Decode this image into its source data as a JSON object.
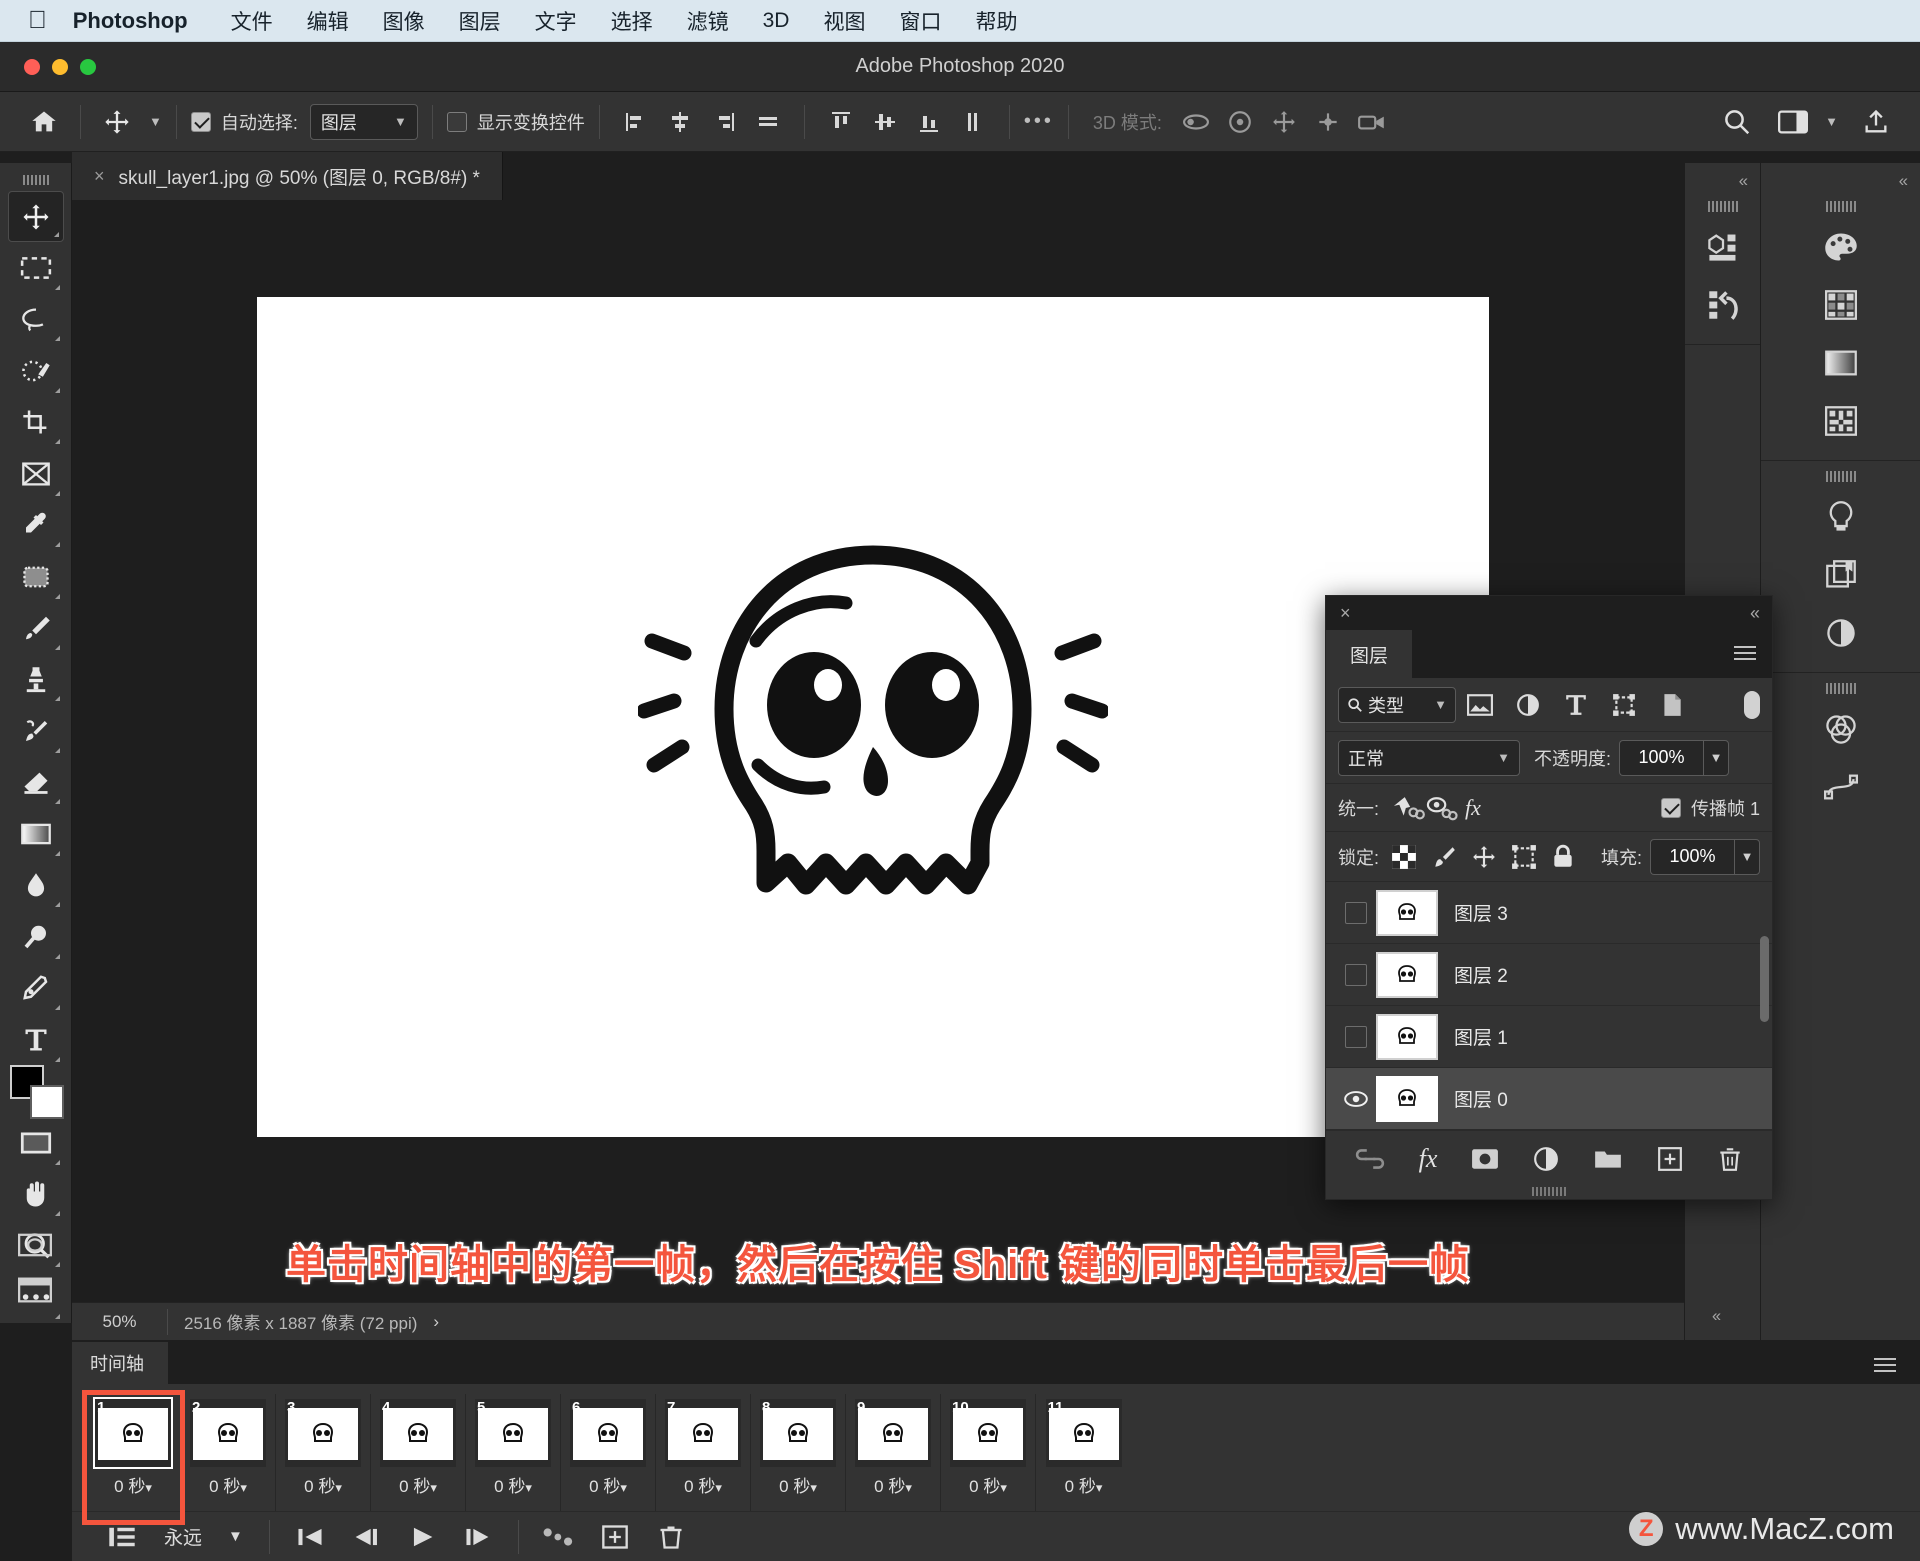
{
  "mac_menu": {
    "apple": "apple-logo",
    "app_name": "Photoshop",
    "items": [
      "文件",
      "编辑",
      "图像",
      "图层",
      "文字",
      "选择",
      "滤镜",
      "3D",
      "视图",
      "窗口",
      "帮助"
    ]
  },
  "window": {
    "title": "Adobe Photoshop 2020"
  },
  "options_bar": {
    "auto_select_label": "自动选择:",
    "auto_select_value": "图层",
    "show_transform_label": "显示变换控件",
    "mode3d_label": "3D 模式:",
    "more_label": "•••"
  },
  "document_tab": {
    "close": "×",
    "title": "skull_layer1.jpg @ 50% (图层 0, RGB/8#) *"
  },
  "status_bar": {
    "zoom": "50%",
    "dimensions": "2516 像素 x 1887 像素 (72 ppi)",
    "arrow": "›"
  },
  "annotation": {
    "text": "单击时间轴中的第一帧，然后在按住 Shift 键的同时单击最后一帧",
    "color": "#f4553d"
  },
  "tools": [
    {
      "name": "move-tool",
      "active": true
    },
    {
      "name": "marquee-tool",
      "active": false
    },
    {
      "name": "lasso-tool",
      "active": false
    },
    {
      "name": "quick-selection-tool",
      "active": false
    },
    {
      "name": "crop-tool",
      "active": false
    },
    {
      "name": "frame-tool",
      "active": false
    },
    {
      "name": "eyedropper-tool",
      "active": false
    },
    {
      "name": "spot-healing-tool",
      "active": false
    },
    {
      "name": "brush-tool",
      "active": false
    },
    {
      "name": "clone-stamp-tool",
      "active": false
    },
    {
      "name": "history-brush-tool",
      "active": false
    },
    {
      "name": "eraser-tool",
      "active": false
    },
    {
      "name": "gradient-tool",
      "active": false
    },
    {
      "name": "blur-tool",
      "active": false
    },
    {
      "name": "dodge-tool",
      "active": false
    },
    {
      "name": "pen-tool",
      "active": false
    },
    {
      "name": "type-tool",
      "active": false
    },
    {
      "name": "path-selection-tool",
      "active": false
    },
    {
      "name": "rectangle-tool",
      "active": false
    },
    {
      "name": "hand-tool",
      "active": false
    },
    {
      "name": "zoom-tool",
      "active": false
    },
    {
      "name": "more-tools",
      "active": false
    }
  ],
  "layers_panel": {
    "close": "×",
    "collapse": "‹‹",
    "tab_label": "图层",
    "filter_placeholder": "类型",
    "filter_icons": [
      "image-filter-icon",
      "adjustment-filter-icon",
      "type-filter-icon",
      "shape-filter-icon",
      "smart-object-filter-icon"
    ],
    "blend_mode": "正常",
    "opacity_label": "不透明度:",
    "opacity_value": "100%",
    "unify_label": "统一:",
    "propagate_label": "传播帧 1",
    "propagate_checked": true,
    "lock_label": "锁定:",
    "fill_label": "填充:",
    "fill_value": "100%",
    "rows": [
      {
        "name": "图层 3",
        "visible": false,
        "selected": false
      },
      {
        "name": "图层 2",
        "visible": false,
        "selected": false
      },
      {
        "name": "图层 1",
        "visible": false,
        "selected": false
      },
      {
        "name": "图层 0",
        "visible": true,
        "selected": true
      }
    ],
    "footer_icons": [
      "link-layers-icon",
      "fx-icon",
      "layer-mask-icon",
      "adjustment-layer-icon",
      "new-group-icon",
      "new-layer-icon",
      "delete-layer-icon"
    ]
  },
  "right_dock": {
    "collapse": "‹‹",
    "group_a": [
      "3d-panel-icon",
      "history-panel-icon"
    ],
    "group_b1": [
      "color-palette-icon",
      "swatches-icon",
      "gradients-icon",
      "patterns-icon"
    ],
    "group_b2": [
      "adjustments-icon",
      "libraries-icon",
      "properties-icon"
    ],
    "group_b3": [
      "channels-icon",
      "paths-icon"
    ]
  },
  "timeline": {
    "tab_label": "时间轴",
    "loop_value": "永远",
    "frames": [
      {
        "num": "1",
        "delay": "0 秒",
        "selected": true
      },
      {
        "num": "2",
        "delay": "0 秒",
        "selected": false
      },
      {
        "num": "3",
        "delay": "0 秒",
        "selected": false
      },
      {
        "num": "4",
        "delay": "0 秒",
        "selected": false
      },
      {
        "num": "5",
        "delay": "0 秒",
        "selected": false
      },
      {
        "num": "6",
        "delay": "0 秒",
        "selected": false
      },
      {
        "num": "7",
        "delay": "0 秒",
        "selected": false
      },
      {
        "num": "8",
        "delay": "0 秒",
        "selected": false
      },
      {
        "num": "9",
        "delay": "0 秒",
        "selected": false
      },
      {
        "num": "10",
        "delay": "0 秒",
        "selected": false
      },
      {
        "num": "11",
        "delay": "0 秒",
        "selected": false
      }
    ],
    "controls": [
      "frame-convert-icon",
      "first-frame-icon",
      "prev-frame-icon",
      "play-icon",
      "next-frame-icon",
      "tween-icon",
      "duplicate-frame-icon",
      "delete-frame-icon"
    ]
  },
  "watermark": {
    "badge": "Z",
    "text": "www.MacZ.com"
  }
}
